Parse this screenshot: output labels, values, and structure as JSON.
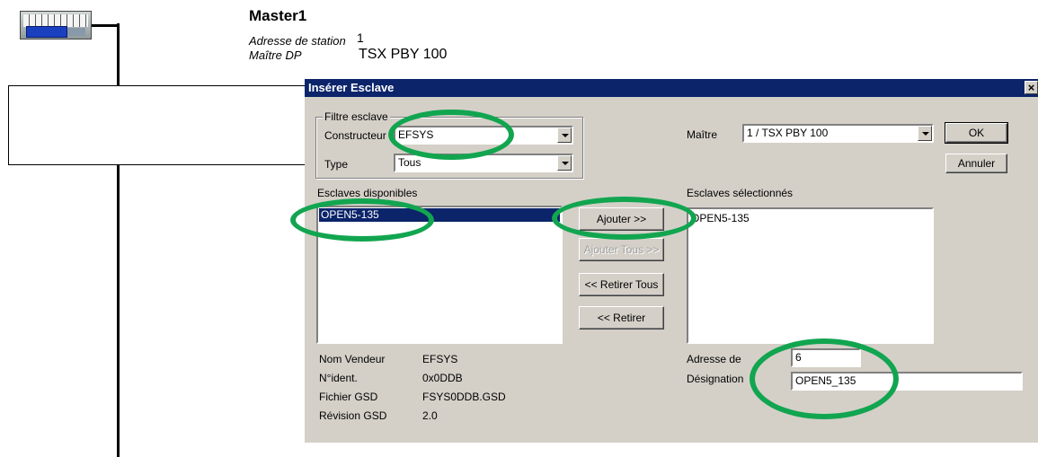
{
  "diagram": {
    "plc_icon": "plc-rack-icon",
    "master": {
      "title": "Master1",
      "station_label": "Adresse de station",
      "station_value": "1",
      "dp_label": "Maître DP",
      "dp_value": "TSX PBY 100"
    }
  },
  "dialog": {
    "title": "Insérer Esclave",
    "close_symbol": "×",
    "filter": {
      "group_label": "Filtre esclave",
      "constructeur_label": "Constructeur",
      "constructeur_value": "EFSYS",
      "type_label": "Type",
      "type_value": "Tous"
    },
    "maitre": {
      "label": "Maître",
      "value": "1 / TSX PBY 100"
    },
    "buttons": {
      "ok": "OK",
      "annuler": "Annuler",
      "ajouter": "Ajouter >>",
      "ajouter_tous": "Ajouter Tous >>",
      "retirer_tous": "<< Retirer Tous",
      "retirer": "<< Retirer"
    },
    "available": {
      "label": "Esclaves disponibles",
      "items": [
        "OPEN5-135"
      ]
    },
    "selected": {
      "label": "Esclaves sélectionnés",
      "items": [
        "OPEN5-135"
      ]
    },
    "info": {
      "vendor_label": "Nom Vendeur",
      "vendor_value": "EFSYS",
      "ident_label": "N°ident.",
      "ident_value": "0x0DDB",
      "gsd_label": "Fichier GSD",
      "gsd_value": "FSYS0DDB.GSD",
      "rev_label": "Révision GSD",
      "rev_value": "2.0"
    },
    "adresse": {
      "label": "Adresse de",
      "value": "6"
    },
    "designation": {
      "label": "Désignation",
      "value": "OPEN5_135"
    }
  },
  "colors": {
    "titlebar": "#0b246a",
    "dialog_bg": "#d4d0c8",
    "highlight_ring": "#12a550"
  }
}
